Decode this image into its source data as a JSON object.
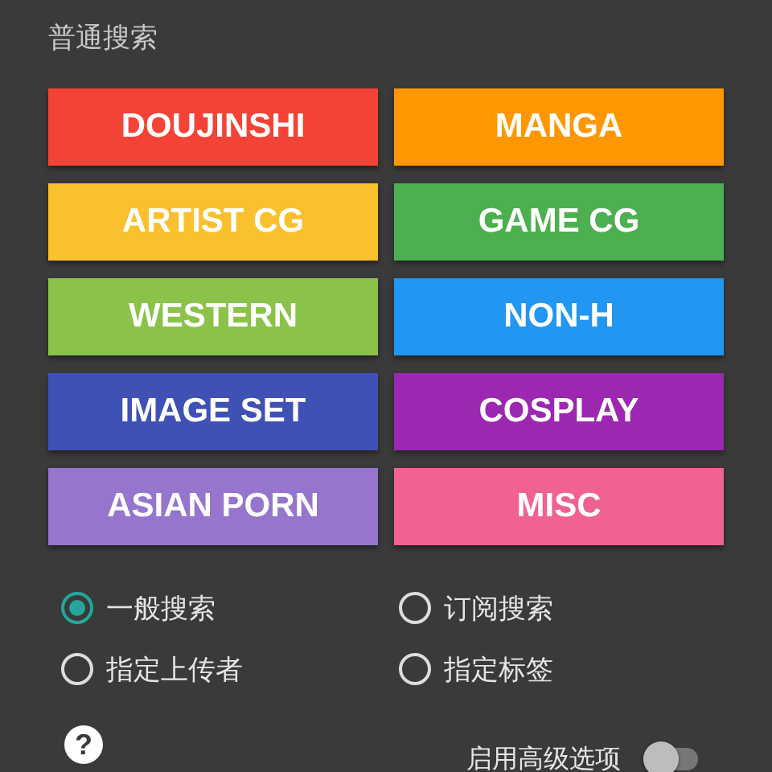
{
  "section_title": "普通搜索",
  "categories": [
    {
      "label": "DOUJINSHI",
      "color": "#f44336",
      "on": true
    },
    {
      "label": "MANGA",
      "color": "#ff9800",
      "on": true
    },
    {
      "label": "ARTIST CG",
      "color": "#fbc02d",
      "on": true
    },
    {
      "label": "GAME CG",
      "color": "#4caf50",
      "on": true
    },
    {
      "label": "WESTERN",
      "color": "#8bc34a",
      "on": true
    },
    {
      "label": "NON-H",
      "color": "#2196f3",
      "on": true
    },
    {
      "label": "IMAGE SET",
      "color": "#3f51b5",
      "on": true
    },
    {
      "label": "COSPLAY",
      "color": "#9c27b0",
      "on": true
    },
    {
      "label": "ASIAN PORN",
      "color": "#9575cd",
      "on": true
    },
    {
      "label": "MISC",
      "color": "#f06292",
      "on": true
    }
  ],
  "search_modes": [
    {
      "label": "一般搜索",
      "selected": true
    },
    {
      "label": "订阅搜索",
      "selected": false
    },
    {
      "label": "指定上传者",
      "selected": false
    },
    {
      "label": "指定标签",
      "selected": false
    }
  ],
  "help": {
    "symbol": "?"
  },
  "advanced": {
    "label": "启用高级选项",
    "on": false
  }
}
